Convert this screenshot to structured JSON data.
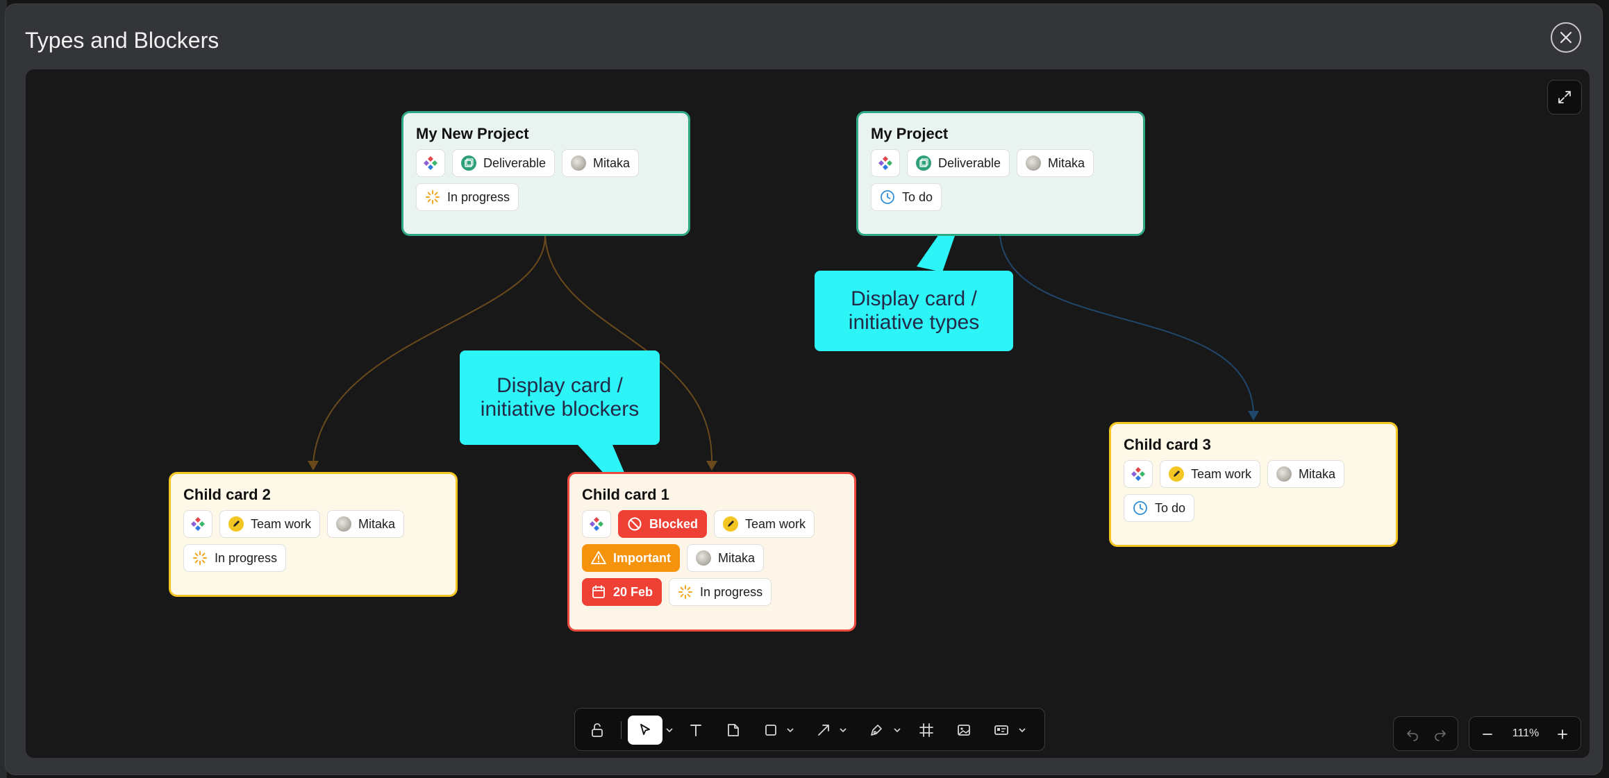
{
  "window": {
    "title": "Types and Blockers"
  },
  "colors": {
    "parent_border": "#2fa985",
    "child_border": "#f3c623",
    "blocked_border": "#ec4a3d",
    "callout": "#2df4f7",
    "link_orange": "#6a4a1c",
    "link_blue": "#20466b"
  },
  "cards": {
    "my_new_project": {
      "title": "My New Project",
      "type": "Deliverable",
      "assignee": "Mitaka",
      "status": "In progress"
    },
    "my_project": {
      "title": "My Project",
      "type": "Deliverable",
      "assignee": "Mitaka",
      "status": "To do"
    },
    "child_card_2": {
      "title": "Child card 2",
      "type": "Team work",
      "assignee": "Mitaka",
      "status": "In progress"
    },
    "child_card_1": {
      "title": "Child card 1",
      "blocker": "Blocked",
      "type": "Team work",
      "priority": "Important",
      "assignee": "Mitaka",
      "due": "20 Feb",
      "status": "In progress"
    },
    "child_card_3": {
      "title": "Child card 3",
      "type": "Team work",
      "assignee": "Mitaka",
      "status": "To do"
    }
  },
  "callouts": {
    "types": [
      "Display card /",
      "initiative types"
    ],
    "blockers": [
      "Display card /",
      "initiative blockers"
    ]
  },
  "zoom": {
    "level": "111%"
  },
  "icons": {
    "close": "close-icon",
    "expand": "expand-icon",
    "app": "app-logo-icon",
    "deliverable": "deliverable-icon",
    "team_work": "pencil-icon",
    "in_progress": "spinner-icon",
    "to_do": "clock-icon",
    "blocked": "blocked-icon",
    "important": "warning-icon",
    "due": "calendar-icon"
  }
}
